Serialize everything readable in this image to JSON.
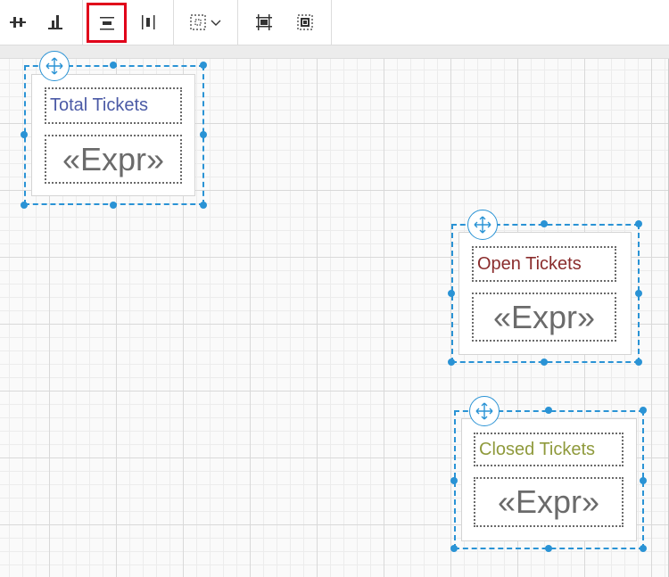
{
  "toolbar": {
    "buttons": [
      {
        "name": "align-centers-vertical-icon"
      },
      {
        "name": "align-bottoms-icon"
      },
      {
        "name": "align-middles-icon",
        "active": true
      },
      {
        "name": "distribute-horizontal-icon"
      },
      {
        "name": "size-to-grid-dropdown-icon"
      },
      {
        "name": "bring-to-front-icon"
      },
      {
        "name": "send-to-back-icon"
      }
    ]
  },
  "widgets": [
    {
      "title": "Total Tickets",
      "title_color": "#4b5aa6",
      "expr": "«Expr»"
    },
    {
      "title": "Open Tickets",
      "title_color": "#8a2c2c",
      "expr": "«Expr»"
    },
    {
      "title": "Closed Tickets",
      "title_color": "#8f9a3c",
      "expr": "«Expr»"
    }
  ],
  "colors": {
    "selection": "#2a93d5",
    "active_outline": "#e0001a"
  }
}
